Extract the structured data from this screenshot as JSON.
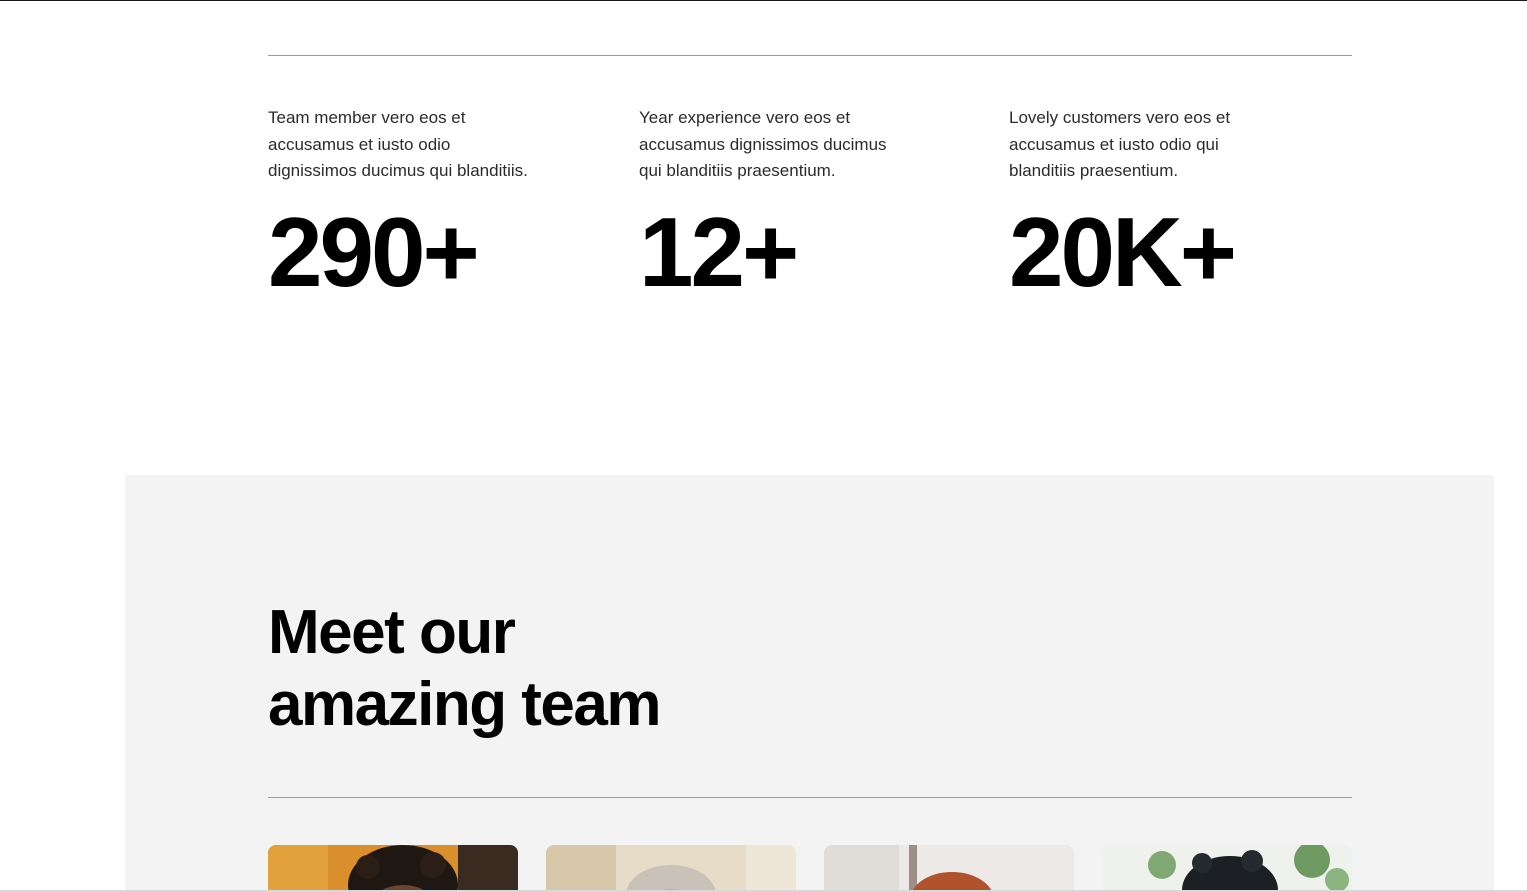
{
  "stats": [
    {
      "description": "Team member vero eos et accusamus et iusto odio dignissimos ducimus qui blanditiis.",
      "value": "290+"
    },
    {
      "description": "Year experience vero eos et accusamus dignissimos ducimus qui blanditiis praesentium.",
      "value": "12+"
    },
    {
      "description": "Lovely customers vero eos et accusamus et iusto odio qui blanditiis praesentium.",
      "value": "20K+"
    }
  ],
  "team": {
    "title_line1": "Meet our",
    "title_line2": "amazing team",
    "members": [
      {
        "photo": "team-member-photo"
      },
      {
        "photo": "team-member-photo"
      },
      {
        "photo": "team-member-photo"
      },
      {
        "photo": "team-member-photo"
      }
    ]
  },
  "colors": {
    "background": "#ffffff",
    "section_background": "#f3f3f3",
    "text": "#000000",
    "rule": "#9a9a9a"
  }
}
